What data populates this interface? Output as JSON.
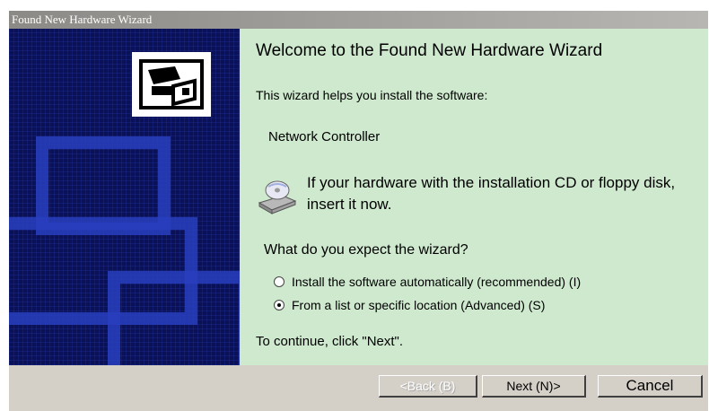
{
  "window": {
    "title": "Found New Hardware Wizard"
  },
  "content": {
    "title": "Welcome to the Found New Hardware Wizard",
    "intro": "This wizard helps you install the software:",
    "device": "Network Controller",
    "cd_prompt": "If your hardware with the installation CD or floppy disk, insert it now.",
    "question": "What do you expect the wizard?",
    "options": [
      {
        "label": "Install the software automatically (recommended) (I)",
        "selected": false
      },
      {
        "label": "From a list or specific location (Advanced) (S)",
        "selected": true
      }
    ],
    "continue_hint": "To continue, click \"Next\"."
  },
  "buttons": {
    "back": "<Back (B)",
    "next": "Next (N)>",
    "cancel": "Cancel"
  },
  "colors": {
    "left_panel": "#0b1156",
    "right_panel": "#cfe9cf",
    "button_face": "#d4d0c8"
  }
}
